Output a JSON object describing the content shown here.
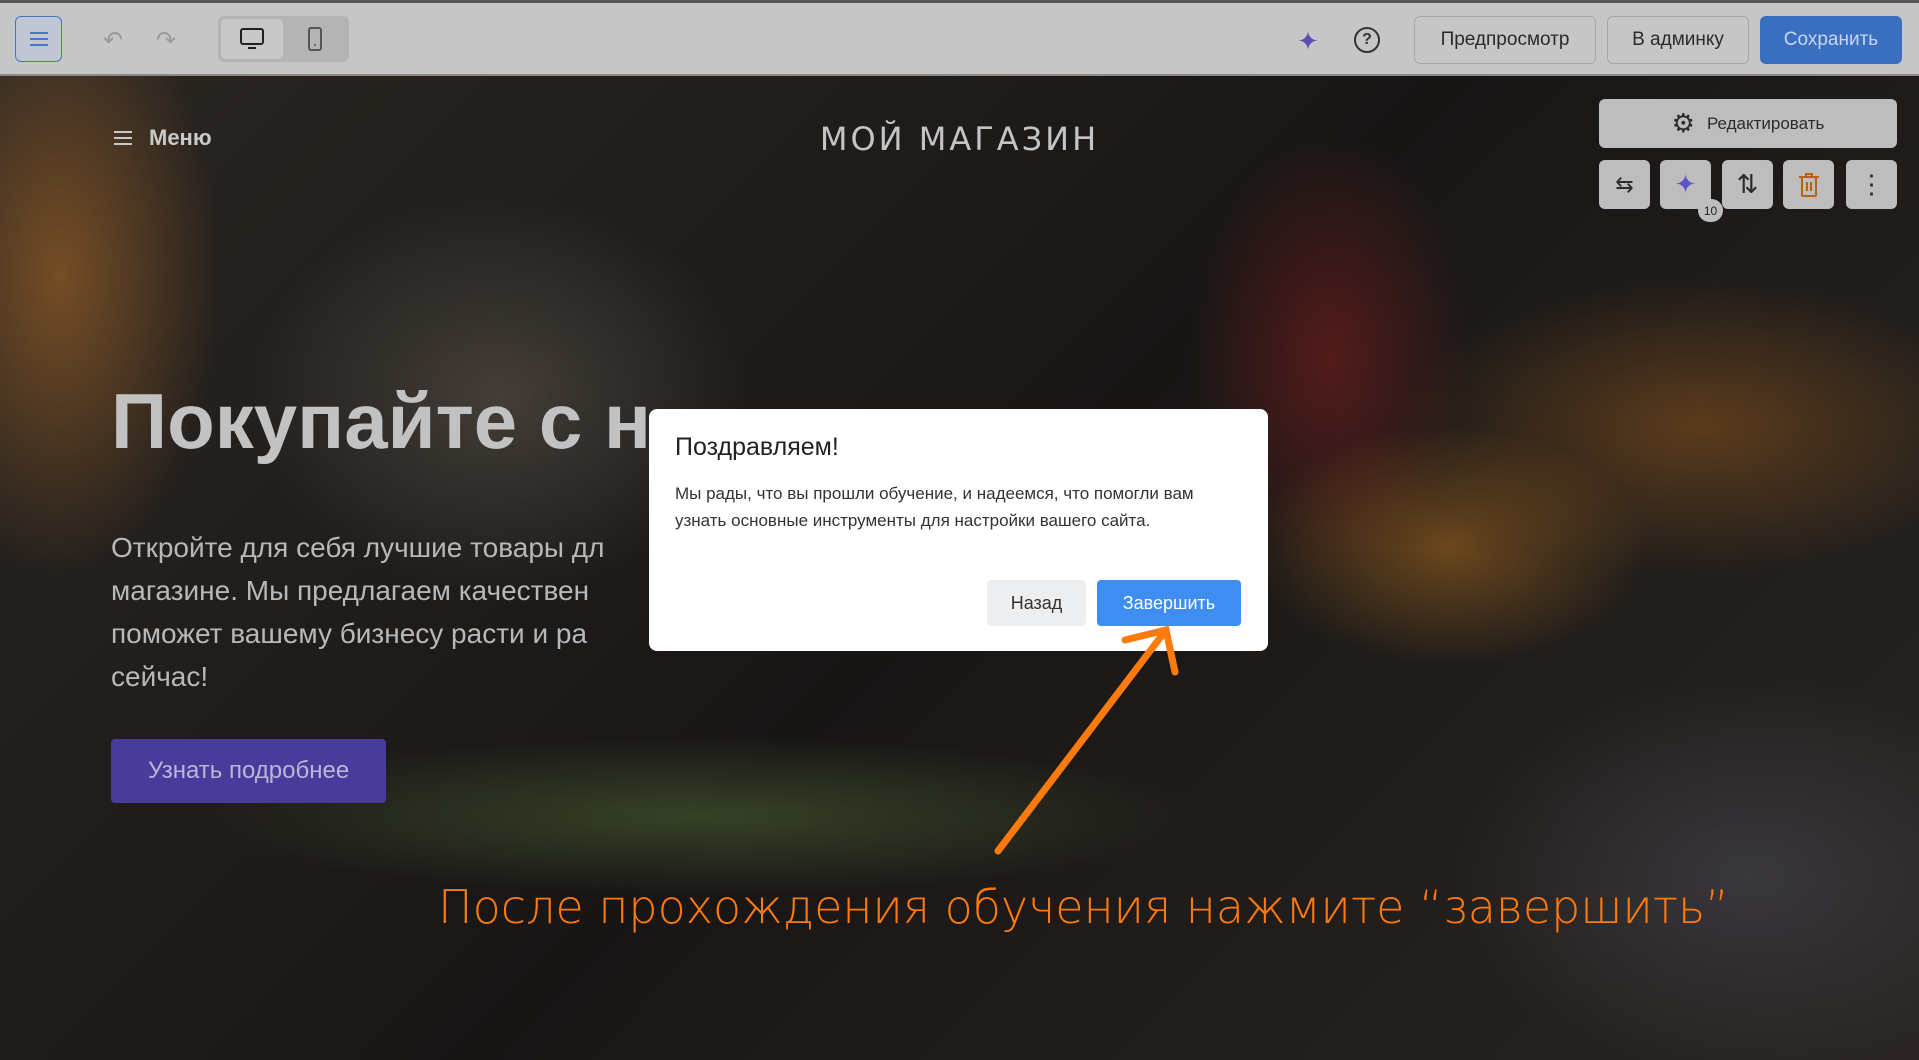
{
  "toolbar": {
    "preview_label": "Предпросмотр",
    "admin_label": "В админку",
    "save_label": "Сохранить",
    "help_glyph": "?"
  },
  "site": {
    "menu_label": "Меню",
    "title": "МОЙ МАГАЗИН"
  },
  "block_tools": {
    "edit_label": "Редактировать",
    "ai_count": "10"
  },
  "hero": {
    "heading": "Покупайте с н",
    "paragraph_lines": [
      "Откройте для себя лучшие товары дл",
      "магазине. Мы предлагаем качествен",
      "поможет вашему бизнесу расти и ра",
      "сейчас!"
    ],
    "cta_label": "Узнать подробнее"
  },
  "dialog": {
    "title": "Поздравляем!",
    "body": "Мы рады, что вы прошли обучение, и надеемся, что помогли вам узнать основные инструменты для настройки вашего сайта.",
    "back_label": "Назад",
    "finish_label": "Завершить"
  },
  "annotation": {
    "text": "После прохождения обучения нажмите “завершить”",
    "color": "#ff7a0d"
  }
}
